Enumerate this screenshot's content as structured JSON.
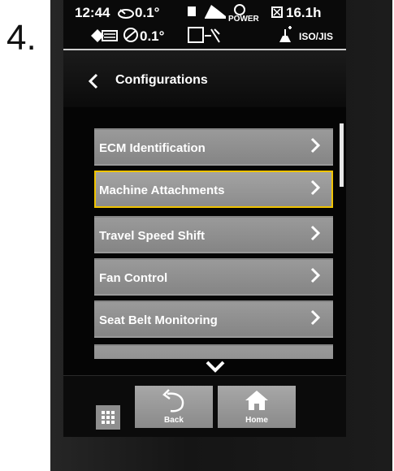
{
  "step_label": "4.",
  "status": {
    "time": "12:44",
    "angle_top": "0.1°",
    "power_label": "POWER",
    "hours": "16.1h",
    "angle_second": "0.1°",
    "pattern_label": "ISO/JIS"
  },
  "header": {
    "title": "Configurations"
  },
  "menu": {
    "items": [
      {
        "label": "ECM Identification"
      },
      {
        "label": "Machine Attachments"
      },
      {
        "label": "Travel Speed Shift"
      },
      {
        "label": "Fan Control"
      },
      {
        "label": "Seat Belt Monitoring"
      },
      {
        "label": ""
      }
    ],
    "selected_index": 1
  },
  "bottom": {
    "back_label": "Back",
    "home_label": "Home"
  },
  "colors": {
    "selection": "#f1c400",
    "item_bg": "#8e8e8e",
    "screen_bg": "#050505"
  }
}
